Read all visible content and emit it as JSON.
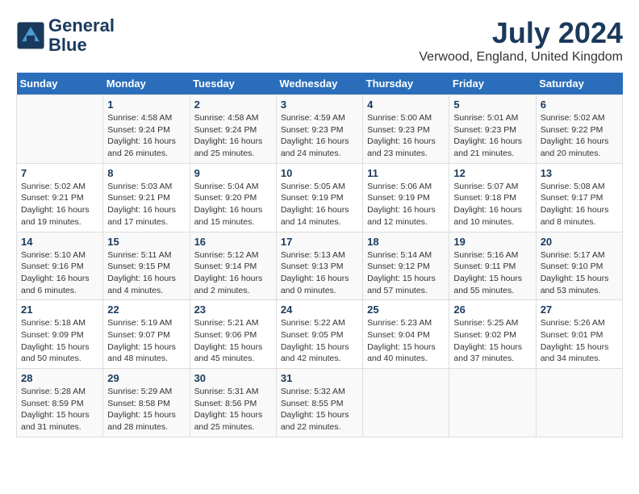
{
  "header": {
    "logo_line1": "General",
    "logo_line2": "Blue",
    "month_year": "July 2024",
    "location": "Verwood, England, United Kingdom"
  },
  "days_of_week": [
    "Sunday",
    "Monday",
    "Tuesday",
    "Wednesday",
    "Thursday",
    "Friday",
    "Saturday"
  ],
  "weeks": [
    [
      {
        "day": "",
        "info": ""
      },
      {
        "day": "1",
        "info": "Sunrise: 4:58 AM\nSunset: 9:24 PM\nDaylight: 16 hours\nand 26 minutes."
      },
      {
        "day": "2",
        "info": "Sunrise: 4:58 AM\nSunset: 9:24 PM\nDaylight: 16 hours\nand 25 minutes."
      },
      {
        "day": "3",
        "info": "Sunrise: 4:59 AM\nSunset: 9:23 PM\nDaylight: 16 hours\nand 24 minutes."
      },
      {
        "day": "4",
        "info": "Sunrise: 5:00 AM\nSunset: 9:23 PM\nDaylight: 16 hours\nand 23 minutes."
      },
      {
        "day": "5",
        "info": "Sunrise: 5:01 AM\nSunset: 9:23 PM\nDaylight: 16 hours\nand 21 minutes."
      },
      {
        "day": "6",
        "info": "Sunrise: 5:02 AM\nSunset: 9:22 PM\nDaylight: 16 hours\nand 20 minutes."
      }
    ],
    [
      {
        "day": "7",
        "info": "Sunrise: 5:02 AM\nSunset: 9:21 PM\nDaylight: 16 hours\nand 19 minutes."
      },
      {
        "day": "8",
        "info": "Sunrise: 5:03 AM\nSunset: 9:21 PM\nDaylight: 16 hours\nand 17 minutes."
      },
      {
        "day": "9",
        "info": "Sunrise: 5:04 AM\nSunset: 9:20 PM\nDaylight: 16 hours\nand 15 minutes."
      },
      {
        "day": "10",
        "info": "Sunrise: 5:05 AM\nSunset: 9:19 PM\nDaylight: 16 hours\nand 14 minutes."
      },
      {
        "day": "11",
        "info": "Sunrise: 5:06 AM\nSunset: 9:19 PM\nDaylight: 16 hours\nand 12 minutes."
      },
      {
        "day": "12",
        "info": "Sunrise: 5:07 AM\nSunset: 9:18 PM\nDaylight: 16 hours\nand 10 minutes."
      },
      {
        "day": "13",
        "info": "Sunrise: 5:08 AM\nSunset: 9:17 PM\nDaylight: 16 hours\nand 8 minutes."
      }
    ],
    [
      {
        "day": "14",
        "info": "Sunrise: 5:10 AM\nSunset: 9:16 PM\nDaylight: 16 hours\nand 6 minutes."
      },
      {
        "day": "15",
        "info": "Sunrise: 5:11 AM\nSunset: 9:15 PM\nDaylight: 16 hours\nand 4 minutes."
      },
      {
        "day": "16",
        "info": "Sunrise: 5:12 AM\nSunset: 9:14 PM\nDaylight: 16 hours\nand 2 minutes."
      },
      {
        "day": "17",
        "info": "Sunrise: 5:13 AM\nSunset: 9:13 PM\nDaylight: 16 hours\nand 0 minutes."
      },
      {
        "day": "18",
        "info": "Sunrise: 5:14 AM\nSunset: 9:12 PM\nDaylight: 15 hours\nand 57 minutes."
      },
      {
        "day": "19",
        "info": "Sunrise: 5:16 AM\nSunset: 9:11 PM\nDaylight: 15 hours\nand 55 minutes."
      },
      {
        "day": "20",
        "info": "Sunrise: 5:17 AM\nSunset: 9:10 PM\nDaylight: 15 hours\nand 53 minutes."
      }
    ],
    [
      {
        "day": "21",
        "info": "Sunrise: 5:18 AM\nSunset: 9:09 PM\nDaylight: 15 hours\nand 50 minutes."
      },
      {
        "day": "22",
        "info": "Sunrise: 5:19 AM\nSunset: 9:07 PM\nDaylight: 15 hours\nand 48 minutes."
      },
      {
        "day": "23",
        "info": "Sunrise: 5:21 AM\nSunset: 9:06 PM\nDaylight: 15 hours\nand 45 minutes."
      },
      {
        "day": "24",
        "info": "Sunrise: 5:22 AM\nSunset: 9:05 PM\nDaylight: 15 hours\nand 42 minutes."
      },
      {
        "day": "25",
        "info": "Sunrise: 5:23 AM\nSunset: 9:04 PM\nDaylight: 15 hours\nand 40 minutes."
      },
      {
        "day": "26",
        "info": "Sunrise: 5:25 AM\nSunset: 9:02 PM\nDaylight: 15 hours\nand 37 minutes."
      },
      {
        "day": "27",
        "info": "Sunrise: 5:26 AM\nSunset: 9:01 PM\nDaylight: 15 hours\nand 34 minutes."
      }
    ],
    [
      {
        "day": "28",
        "info": "Sunrise: 5:28 AM\nSunset: 8:59 PM\nDaylight: 15 hours\nand 31 minutes."
      },
      {
        "day": "29",
        "info": "Sunrise: 5:29 AM\nSunset: 8:58 PM\nDaylight: 15 hours\nand 28 minutes."
      },
      {
        "day": "30",
        "info": "Sunrise: 5:31 AM\nSunset: 8:56 PM\nDaylight: 15 hours\nand 25 minutes."
      },
      {
        "day": "31",
        "info": "Sunrise: 5:32 AM\nSunset: 8:55 PM\nDaylight: 15 hours\nand 22 minutes."
      },
      {
        "day": "",
        "info": ""
      },
      {
        "day": "",
        "info": ""
      },
      {
        "day": "",
        "info": ""
      }
    ]
  ]
}
